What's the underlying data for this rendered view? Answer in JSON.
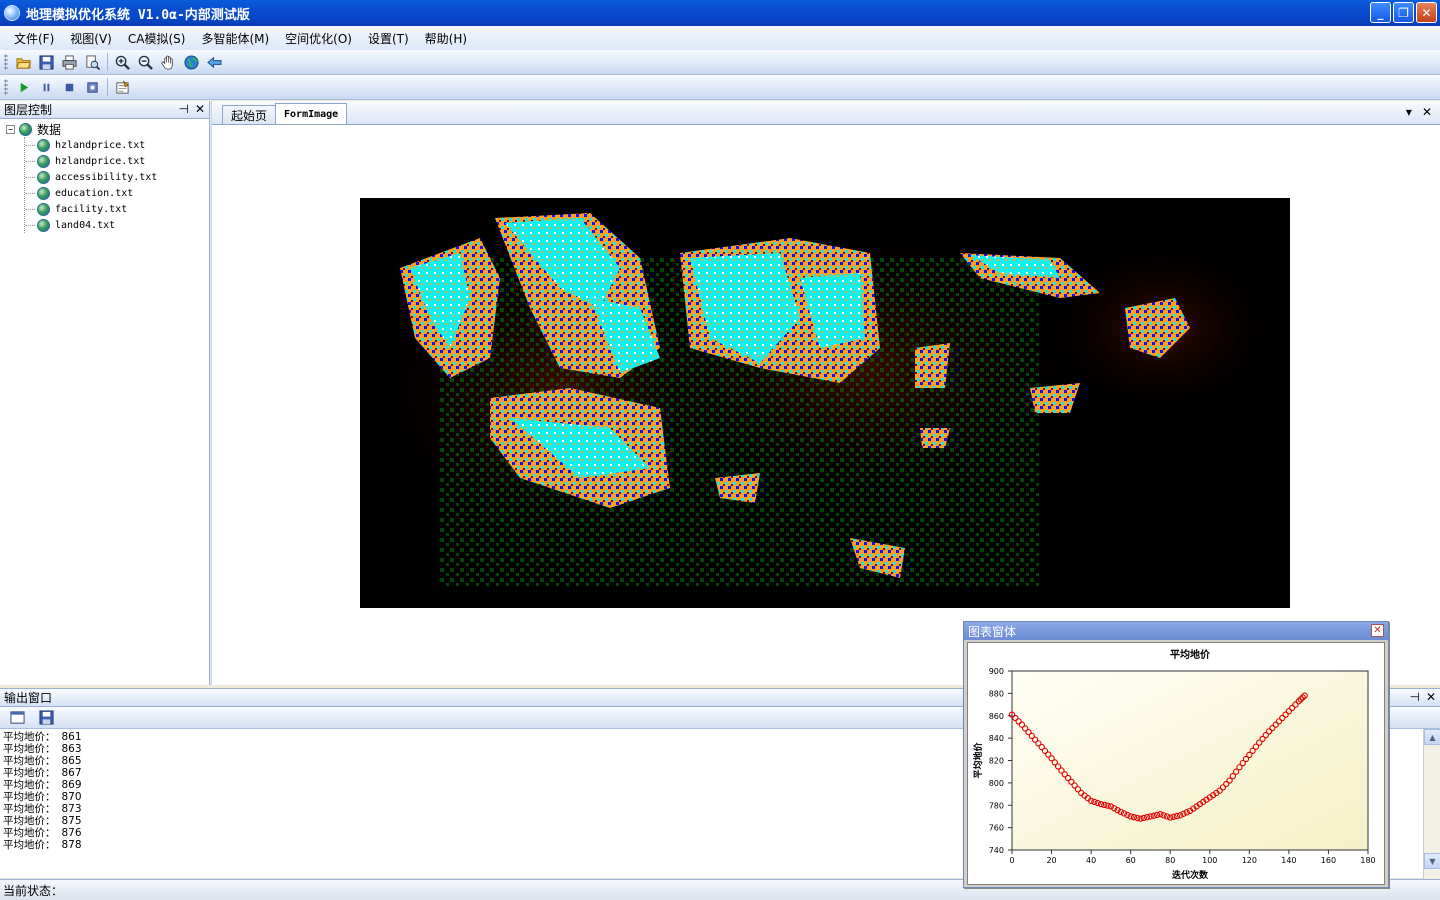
{
  "window": {
    "title": "地理模拟优化系统 V1.0α-内部测试版"
  },
  "menu": [
    "文件(F)",
    "视图(V)",
    "CA模拟(S)",
    "多智能体(M)",
    "空间优化(O)",
    "设置(T)",
    "帮助(H)"
  ],
  "toolbar1": [
    "open-folder-icon",
    "save-icon",
    "print-icon",
    "print-preview-icon",
    "zoom-in-icon",
    "zoom-out-icon",
    "pan-hand-icon",
    "globe-icon",
    "back-arrow-icon"
  ],
  "toolbar2": [
    "play-icon",
    "pause-icon",
    "stop-icon",
    "step-icon",
    "properties-icon"
  ],
  "layer_panel": {
    "title": "图层控制",
    "pin": "⊣",
    "close": "✕",
    "root": {
      "toggle": "−",
      "label": "数据"
    },
    "items": [
      "hzlandprice.txt",
      "hzlandprice.txt",
      "accessibility.txt",
      "education.txt",
      "facility.txt",
      "land04.txt"
    ]
  },
  "tabs": [
    {
      "label": "起始页"
    },
    {
      "label": "FormImage"
    }
  ],
  "tab_controls": {
    "dropdown": "▾",
    "close": "✕"
  },
  "output_panel": {
    "title": "输出窗口",
    "pin": "⊣",
    "close": "✕",
    "lines": [
      {
        "label": "平均地价：",
        "value": "861"
      },
      {
        "label": "平均地价：",
        "value": "863"
      },
      {
        "label": "平均地价：",
        "value": "865"
      },
      {
        "label": "平均地价：",
        "value": "867"
      },
      {
        "label": "平均地价：",
        "value": "869"
      },
      {
        "label": "平均地价：",
        "value": "870"
      },
      {
        "label": "平均地价：",
        "value": "873"
      },
      {
        "label": "平均地价：",
        "value": "875"
      },
      {
        "label": "平均地价：",
        "value": "876"
      },
      {
        "label": "平均地价：",
        "value": "878"
      }
    ],
    "scroll_up": "▲",
    "scroll_down": "▼"
  },
  "status": {
    "label": "当前状态："
  },
  "chart_window": {
    "title": "图表窗体",
    "close": "✕"
  },
  "chart_data": {
    "type": "scatter",
    "title": "平均地价",
    "xlabel": "迭代次数",
    "ylabel": "平均地价",
    "xlim": [
      0,
      180
    ],
    "ylim": [
      740,
      900
    ],
    "xticks": [
      0,
      20,
      40,
      60,
      80,
      100,
      120,
      140,
      160,
      180
    ],
    "yticks": [
      740,
      760,
      780,
      800,
      820,
      840,
      860,
      880,
      900
    ],
    "color": "#e00000",
    "x": [
      0,
      5,
      10,
      15,
      20,
      25,
      30,
      35,
      40,
      45,
      50,
      55,
      60,
      65,
      70,
      75,
      80,
      85,
      90,
      95,
      100,
      105,
      110,
      115,
      120,
      125,
      130,
      135,
      140,
      145,
      148
    ],
    "y": [
      861,
      852,
      842,
      832,
      822,
      811,
      801,
      791,
      784,
      781,
      779,
      774,
      770,
      768,
      770,
      772,
      769,
      771,
      775,
      781,
      787,
      793,
      802,
      814,
      825,
      836,
      846,
      855,
      864,
      873,
      878
    ]
  }
}
